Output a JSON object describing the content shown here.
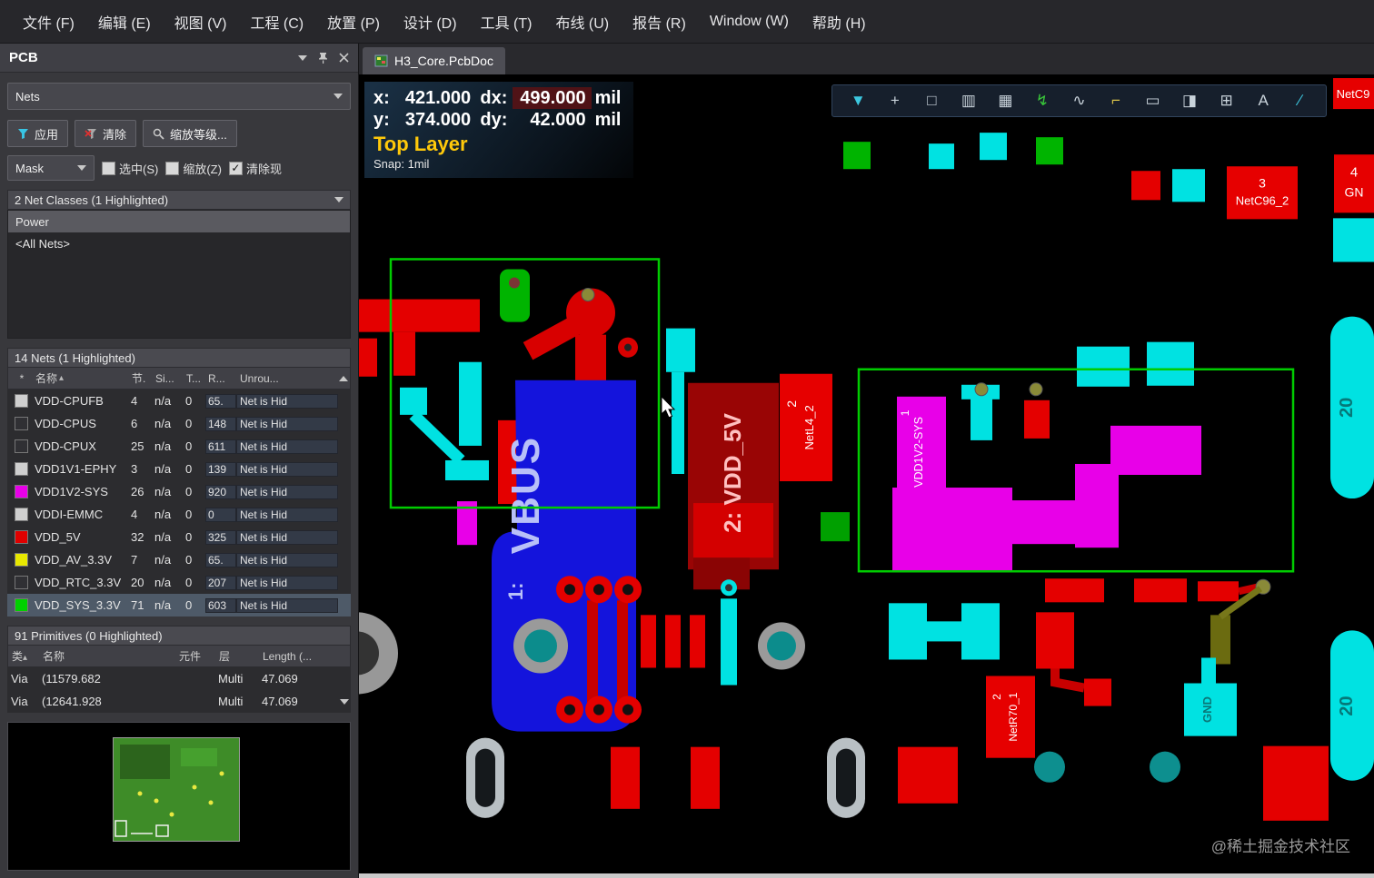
{
  "menu": {
    "items": [
      "文件 (F)",
      "编辑 (E)",
      "视图 (V)",
      "工程 (C)",
      "放置 (P)",
      "设计 (D)",
      "工具 (T)",
      "布线 (U)",
      "报告 (R)",
      "Window (W)",
      "帮助 (H)"
    ]
  },
  "panel": {
    "title": "PCB",
    "mode_select": "Nets",
    "apply_button": "应用",
    "clear_button": "清除",
    "zoom_button": "缩放等级...",
    "mask_select": "Mask",
    "checkbox_select": "选中(S)",
    "checkbox_zoom": "缩放(Z)",
    "checkbox_clear": "清除现",
    "tick_glyph": "✓",
    "net_classes": {
      "header": "2 Net Classes (1 Highlighted)",
      "items": [
        {
          "name": "Power",
          "selected": true
        },
        {
          "name": "<All Nets>",
          "selected": false
        }
      ]
    },
    "nets": {
      "header": "14 Nets (1 Highlighted)",
      "sort_glyph": "▴",
      "columns": [
        "名称",
        "节.",
        "Si...",
        "T...",
        "R...",
        "Unrou..."
      ],
      "rows": [
        {
          "checked": false,
          "color": "#cfcfcf",
          "tick": "#111",
          "name": "VDD-CPUFB",
          "nodes": "4",
          "si": "n/a",
          "t": "0",
          "r": "65.",
          "unrouted": "Net is Hid",
          "selected": false
        },
        {
          "checked": true,
          "color": "#303034",
          "tick": "#fff",
          "name": "VDD-CPUS",
          "nodes": "6",
          "si": "n/a",
          "t": "0",
          "r": "148",
          "unrouted": "Net is Hid",
          "selected": false
        },
        {
          "checked": true,
          "color": "#303034",
          "tick": "#fff",
          "name": "VDD-CPUX",
          "nodes": "25",
          "si": "n/a",
          "t": "0",
          "r": "611",
          "unrouted": "Net is Hid",
          "selected": false
        },
        {
          "checked": false,
          "color": "#cfcfcf",
          "tick": "#111",
          "name": "VDD1V1-EPHY",
          "nodes": "3",
          "si": "n/a",
          "t": "0",
          "r": "139",
          "unrouted": "Net is Hid",
          "selected": false
        },
        {
          "checked": true,
          "color": "#e800e8",
          "tick": "#000",
          "name": "VDD1V2-SYS",
          "nodes": "26",
          "si": "n/a",
          "t": "0",
          "r": "920",
          "unrouted": "Net is Hid",
          "selected": false
        },
        {
          "checked": false,
          "color": "#cfcfcf",
          "tick": "#111",
          "name": "VDDI-EMMC",
          "nodes": "4",
          "si": "n/a",
          "t": "0",
          "r": "0",
          "unrouted": "Net is Hid",
          "selected": false
        },
        {
          "checked": true,
          "color": "#e00000",
          "tick": "#000",
          "name": "VDD_5V",
          "nodes": "32",
          "si": "n/a",
          "t": "0",
          "r": "325",
          "unrouted": "Net is Hid",
          "selected": false
        },
        {
          "checked": true,
          "color": "#e8e800",
          "tick": "#000",
          "name": "VDD_AV_3.3V",
          "nodes": "7",
          "si": "n/a",
          "t": "0",
          "r": "65.",
          "unrouted": "Net is Hid",
          "selected": false
        },
        {
          "checked": true,
          "color": "#303034",
          "tick": "#fff",
          "name": "VDD_RTC_3.3V",
          "nodes": "20",
          "si": "n/a",
          "t": "0",
          "r": "207",
          "unrouted": "Net is Hid",
          "selected": false
        },
        {
          "checked": true,
          "color": "#00d000",
          "tick": "#000",
          "name": "VDD_SYS_3.3V",
          "nodes": "71",
          "si": "n/a",
          "t": "0",
          "r": "603",
          "unrouted": "Net is Hid",
          "selected": true
        }
      ]
    },
    "primitives": {
      "header": "91 Primitives (0 Highlighted)",
      "sort_glyph": "▴",
      "columns": [
        "类",
        "名称",
        "元件",
        "层",
        "Length (..."
      ],
      "rows": [
        {
          "type": "Via",
          "name": "(11579.682",
          "component": "",
          "layer": "Multi",
          "length": "47.069"
        },
        {
          "type": "Via",
          "name": "(12641.928",
          "component": "",
          "layer": "Multi",
          "length": "47.069"
        }
      ]
    }
  },
  "editor": {
    "tab": "H3_Core.PcbDoc",
    "toolbar": {
      "icons": [
        {
          "name": "filter",
          "glyph": "▼"
        },
        {
          "name": "cross-probe",
          "glyph": "+"
        },
        {
          "name": "select-area",
          "glyph": "□"
        },
        {
          "name": "histogram",
          "glyph": "▥"
        },
        {
          "name": "pad-matrix",
          "glyph": "▦"
        },
        {
          "name": "route-trace",
          "glyph": "↯"
        },
        {
          "name": "arc-curve",
          "glyph": "∿"
        },
        {
          "name": "key",
          "glyph": "⌐"
        },
        {
          "name": "rectangle",
          "glyph": "▭"
        },
        {
          "name": "contrast",
          "glyph": "◨"
        },
        {
          "name": "measure-grid",
          "glyph": "⊞"
        },
        {
          "name": "text-string",
          "glyph": "A"
        },
        {
          "name": "line",
          "glyph": "∕"
        }
      ]
    },
    "hud": {
      "x_label": "x:",
      "x_value": "421.000",
      "dx_label": "dx:",
      "dx_value": "499.000",
      "x_unit": "mil",
      "y_label": "y:",
      "y_value": "374.000",
      "dy_label": "dy:",
      "dy_value": "42.000",
      "y_unit": "mil",
      "layer": "Top Layer",
      "snap": "Snap: 1mil"
    },
    "pcb_labels": {
      "vbus": "VBUS",
      "vbus_prefix": "1:",
      "vdd5v": "2: VDD_5V",
      "netl4_pin": "2",
      "netl4": "NetL4_2",
      "vdd1v2_pin": "1",
      "vdd1v2": "VDD1V2-SYS",
      "netc96_pin": "3",
      "netc96": "NetC96_2",
      "netr70_pin": "2",
      "netr70": "NetR70_1",
      "gnd": "GND",
      "right_pad_top": "20",
      "right_pad_bottom": "20",
      "corner_net": "NetC9",
      "edge_pin": "4",
      "edge_net": "GN"
    }
  },
  "watermark": "@稀土掘金技术社区"
}
